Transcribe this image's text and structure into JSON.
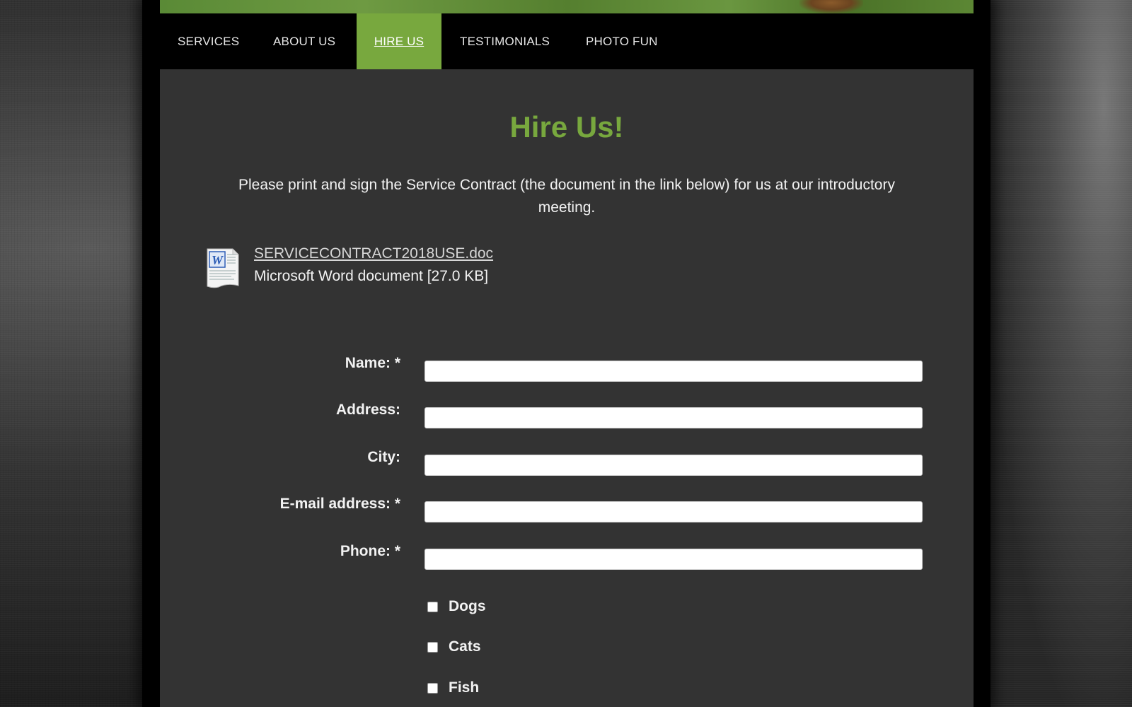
{
  "nav": {
    "items": [
      {
        "label": "SERVICES"
      },
      {
        "label": "ABOUT US"
      },
      {
        "label": "HIRE US"
      },
      {
        "label": "TESTIMONIALS"
      },
      {
        "label": "PHOTO FUN"
      }
    ],
    "active": "HIRE US"
  },
  "page": {
    "title": "Hire Us!",
    "intro": "Please print and sign the Service Contract (the document in the link below) for us at our introductory meeting."
  },
  "download": {
    "icon": "word-document-icon",
    "filename": "SERVICECONTRACT2018USE.doc",
    "meta": "Microsoft Word document [27.0 KB]"
  },
  "form": {
    "fields": [
      {
        "label": "Name: *",
        "value": ""
      },
      {
        "label": "Address:",
        "value": ""
      },
      {
        "label": "City:",
        "value": ""
      },
      {
        "label": "E-mail address: *",
        "value": ""
      },
      {
        "label": "Phone: *",
        "value": ""
      }
    ],
    "checkboxes": [
      {
        "label": "Dogs",
        "checked": false
      },
      {
        "label": "Cats",
        "checked": false
      },
      {
        "label": "Fish",
        "checked": false
      }
    ]
  },
  "colors": {
    "accent": "#78a83e",
    "content_bg": "#333333",
    "nav_bg": "#000000"
  }
}
